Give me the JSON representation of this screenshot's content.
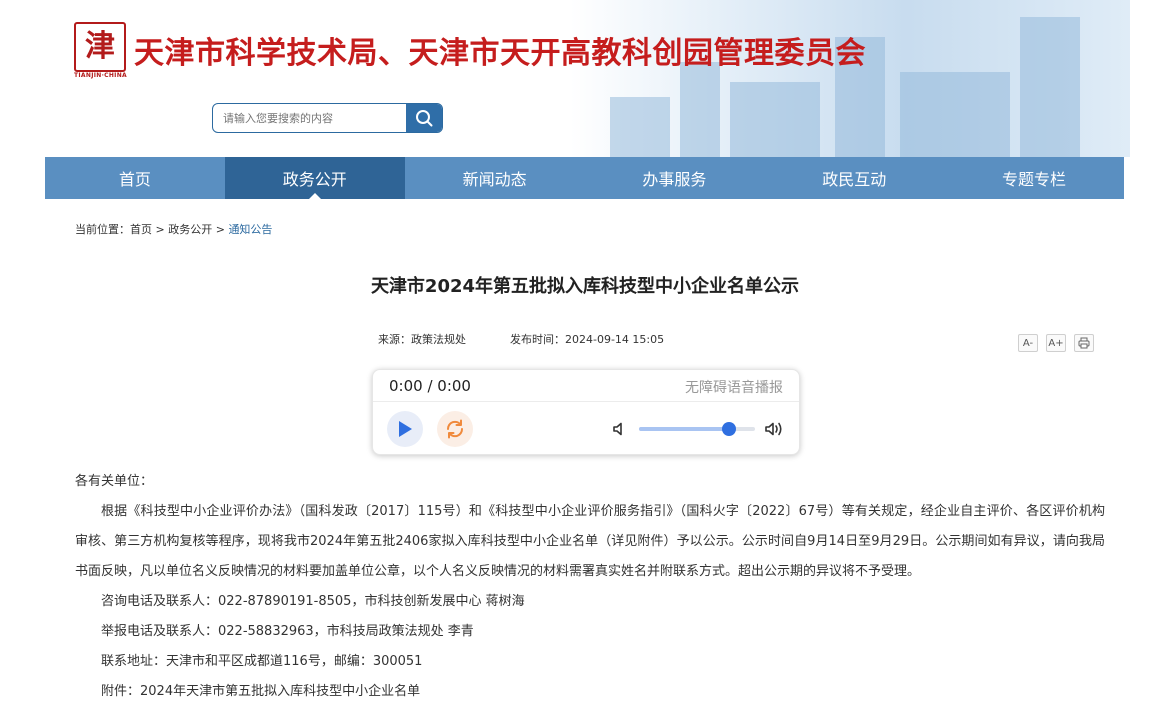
{
  "header": {
    "site_title": "天津市科学技术局、天津市天开高教科创园管理委员会",
    "logo_glyph": "津",
    "logo_sub": "TIANJIN·CHINA"
  },
  "search": {
    "placeholder": "请输入您要搜索的内容",
    "icon": "search-icon"
  },
  "nav": {
    "items": [
      {
        "label": "首页"
      },
      {
        "label": "政务公开"
      },
      {
        "label": "新闻动态"
      },
      {
        "label": "办事服务"
      },
      {
        "label": "政民互动"
      },
      {
        "label": "专题专栏"
      }
    ],
    "active_index": 1
  },
  "breadcrumb": {
    "prefix": "当前位置：",
    "items": [
      "首页",
      "政务公开",
      "通知公告"
    ],
    "sep": " > "
  },
  "article": {
    "title": "天津市2024年第五批拟入库科技型中小企业名单公示",
    "source": "来源：政策法规处",
    "published": "发布时间：2024-09-14 15:05"
  },
  "tools": {
    "font_decrease": "A-",
    "font_increase": "A+",
    "print_icon": "print-icon"
  },
  "player": {
    "time": "0:00 / 0:00",
    "label": "无障碍语音播报",
    "volume_fraction": 0.78,
    "colors": {
      "accent": "#2f6fe0",
      "loop": "#f08a3c"
    }
  },
  "body": {
    "greeting": "各有关单位：",
    "paragraph": "根据《科技型中小企业评价办法》（国科发政〔2017〕115号）和《科技型中小企业评价服务指引》（国科火字〔2022〕67号）等有关规定，经企业自主评价、各区评价机构审核、第三方机构复核等程序，现将我市2024年第五批2406家拟入库科技型中小企业名单（详见附件）予以公示。公示时间自9月14日至9月29日。公示期间如有异议，请向我局书面反映，凡以单位名义反映情况的材料要加盖单位公章，以个人名义反映情况的材料需署真实姓名并附联系方式。超出公示期的异议将不予受理。",
    "consult": "咨询电话及联系人：022-87890191-8505，市科技创新发展中心 蒋树海",
    "report": "举报电话及联系人：022-58832963，市科技局政策法规处 李青",
    "address": "联系地址：天津市和平区成都道116号，邮编：300051",
    "attachment": "附件：2024年天津市第五批拟入库科技型中小企业名单"
  },
  "colors": {
    "title_red": "#c51d1d",
    "nav_blue": "#5a8fc1",
    "nav_active": "#2f6496"
  }
}
